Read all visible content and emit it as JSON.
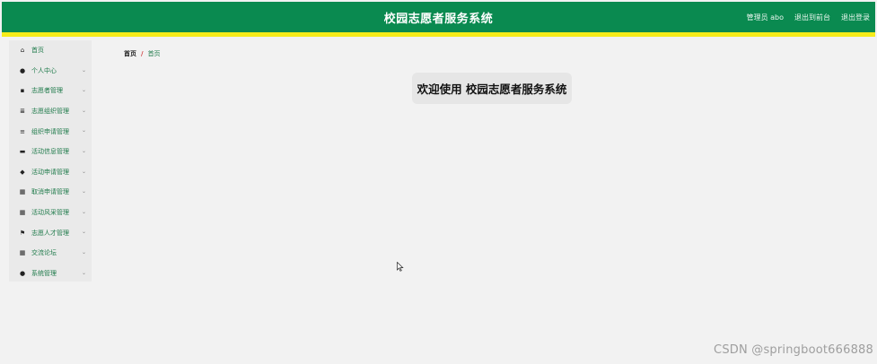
{
  "header": {
    "title": "校园志愿者服务系统",
    "admin_label": "管理员 abo",
    "to_frontend": "退出到前台",
    "logout": "退出登录"
  },
  "sidebar": {
    "items": [
      {
        "label": "首页",
        "icon": "home-icon",
        "glyph": "⌂",
        "has_chevron": false
      },
      {
        "label": "个人中心",
        "icon": "user-icon",
        "glyph": "●",
        "has_chevron": true
      },
      {
        "label": "志愿者管理",
        "icon": "clipboard-icon",
        "glyph": "▪",
        "has_chevron": true
      },
      {
        "label": "志愿组织管理",
        "icon": "list-icon",
        "glyph": "≣",
        "has_chevron": true
      },
      {
        "label": "组织申请管理",
        "icon": "menu-icon",
        "glyph": "≡",
        "has_chevron": true
      },
      {
        "label": "活动信息管理",
        "icon": "ticket-icon",
        "glyph": "▬",
        "has_chevron": true
      },
      {
        "label": "活动申请管理",
        "icon": "thumbs-up-icon",
        "glyph": "◆",
        "has_chevron": true
      },
      {
        "label": "取消申请管理",
        "icon": "grid-icon",
        "glyph": "▦",
        "has_chevron": true
      },
      {
        "label": "活动风采管理",
        "icon": "grid-icon",
        "glyph": "▦",
        "has_chevron": true
      },
      {
        "label": "志愿人才管理",
        "icon": "flag-icon",
        "glyph": "⚑",
        "has_chevron": true
      },
      {
        "label": "交流论坛",
        "icon": "grid-icon",
        "glyph": "▦",
        "has_chevron": true
      },
      {
        "label": "系统管理",
        "icon": "pin-icon",
        "glyph": "●",
        "has_chevron": true
      }
    ]
  },
  "breadcrumb": {
    "home": "首页",
    "separator": "/",
    "current": "首页"
  },
  "main": {
    "welcome": "欢迎使用 校园志愿者服务系统"
  },
  "watermark": "CSDN @springboot666888",
  "colors": {
    "header_bg": "#0a8a50",
    "header_stripe": "#f6ec1a",
    "accent_text": "#1f7a4a"
  }
}
